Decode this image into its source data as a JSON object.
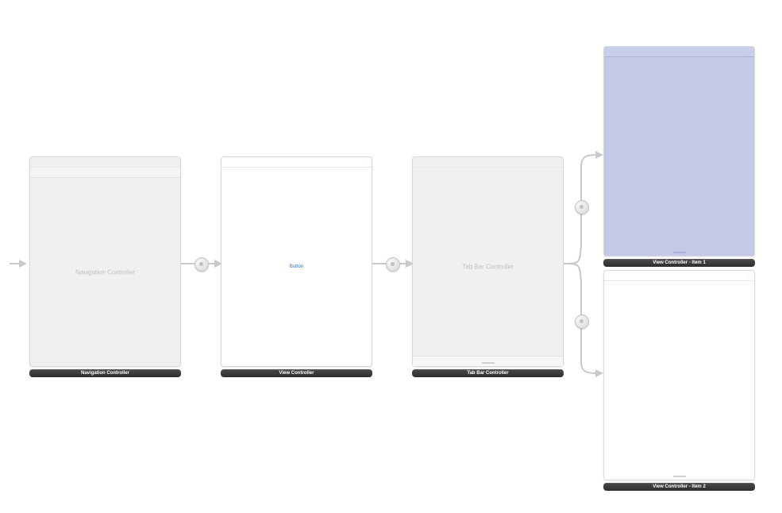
{
  "scenes": {
    "nav": {
      "label": "Navigation Controller",
      "placeholder": "Navigation Controller"
    },
    "vc": {
      "label": "View Controller",
      "button": "Button"
    },
    "tab": {
      "label": "Tab Bar Controller",
      "placeholder": "Tab Bar Controller"
    },
    "item1": {
      "label": "View Controller - Item 1"
    },
    "item2": {
      "label": "View Controller - Item 2"
    }
  }
}
